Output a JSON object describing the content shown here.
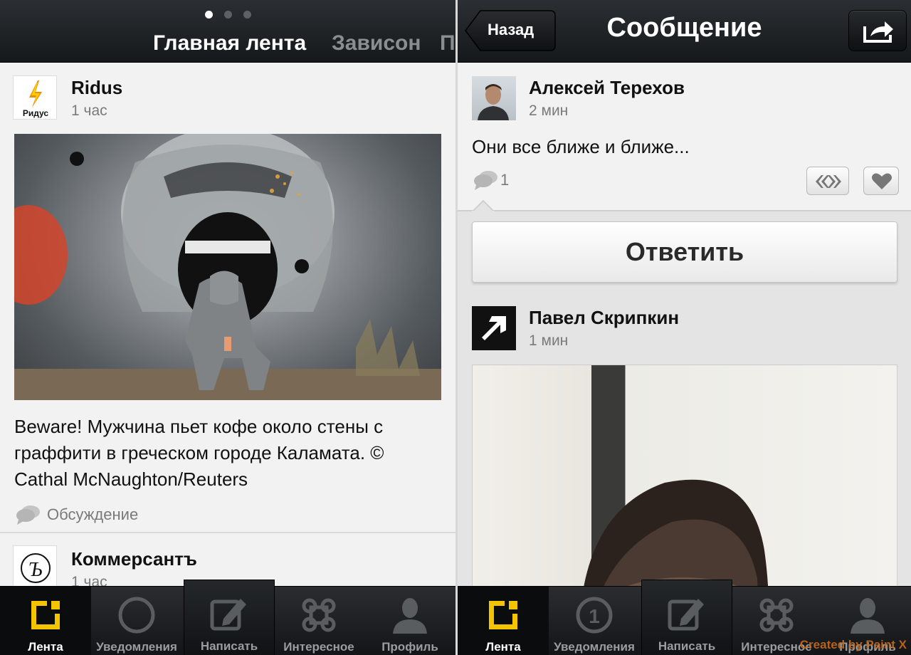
{
  "left": {
    "pager": {
      "count": 3,
      "active": 0
    },
    "tabs": [
      "Главная лента",
      "Зависон",
      "П"
    ],
    "posts": [
      {
        "author": "Ridus",
        "logo_text": "Ридус",
        "time": "1 час",
        "text": "Beware! Мужчина пьет кофе около стены с граффити в греческом городе Каламата. © Cathal McNaughton/Reuters",
        "discussion_label": "Обсуждение"
      },
      {
        "author": "Коммерсантъ",
        "logo_text": "Ъ",
        "time": "1 час"
      }
    ]
  },
  "right": {
    "back_label": "Назад",
    "title": "Сообщение",
    "message": {
      "author": "Алексей Терехов",
      "time": "2 мин",
      "text": "Они все ближе и ближе...",
      "comments_count": "1"
    },
    "reply_label": "Ответить",
    "next_post": {
      "author": "Павел Скрипкин",
      "time": "1 мин"
    }
  },
  "tabbar": {
    "items": [
      {
        "label": "Лента",
        "icon": "feed-icon"
      },
      {
        "label": "Уведомления",
        "icon": "notifications-icon",
        "badge": "1"
      },
      {
        "label": "Написать",
        "icon": "compose-icon"
      },
      {
        "label": "Интересное",
        "icon": "command-icon"
      },
      {
        "label": "Профиль",
        "icon": "profile-icon"
      }
    ]
  },
  "watermark": "Created by Paint X",
  "colors": {
    "accent_yellow": "#f5c400",
    "bar_dark": "#15181b",
    "bg_light": "#f2f2f2",
    "watermark": "#c66a1d"
  }
}
